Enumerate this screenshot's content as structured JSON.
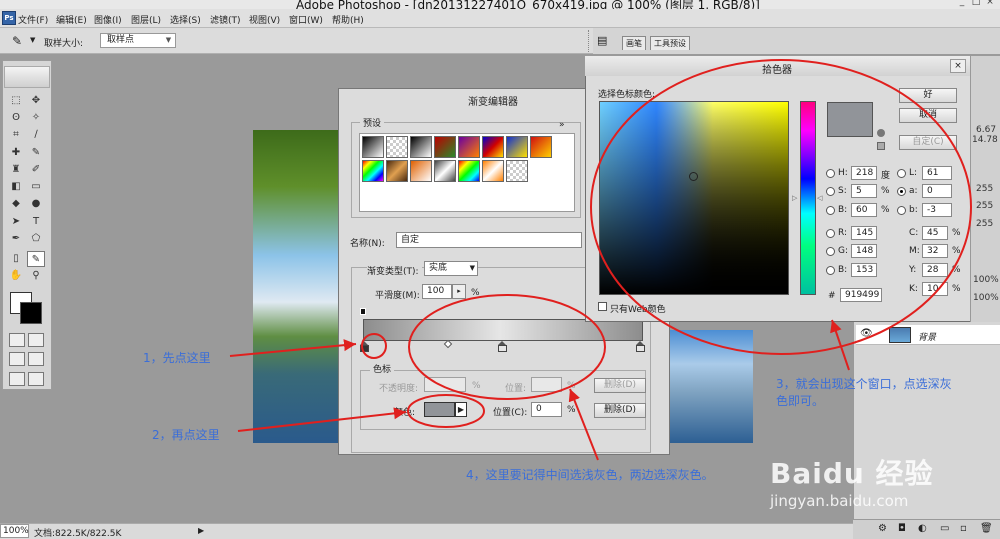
{
  "window": {
    "title": "Adobe Photoshop - [dn20131227401O_670x419.jpg @ 100% (图层 1, RGB/8)]",
    "controls": [
      "_",
      "□",
      "×"
    ]
  },
  "menu": [
    "文件(F)",
    "编辑(E)",
    "图像(I)",
    "图层(L)",
    "选择(S)",
    "滤镜(T)",
    "视图(V)",
    "窗口(W)",
    "帮助(H)"
  ],
  "options_bar": {
    "sample_size_label": "取样大小:",
    "sample_size_value": "取样点"
  },
  "panel_tabs": [
    "画笔",
    "工具预设"
  ],
  "gradient_editor": {
    "title": "渐变编辑器",
    "presets_label": "预设",
    "presets_more": "»",
    "name_label": "名称(N):",
    "name_value": "自定",
    "gradient_type_label": "渐变类型(T):",
    "gradient_type_value": "实底",
    "smoothness_label": "平滑度(M):",
    "smoothness_value": "100",
    "smoothness_unit": "%",
    "stops_label": "色标",
    "opacity_label": "不透明度:",
    "opacity_unit": "%",
    "location_label_dim": "位置:",
    "location_unit_dim": "%",
    "delete_label_dim": "删除(D)",
    "color_label": "颜色:",
    "location_label": "位置(C):",
    "location_value": "0",
    "location_unit": "%",
    "delete_label": "删除(D)"
  },
  "color_picker": {
    "title": "拾色器",
    "prompt": "选择色标颜色:",
    "ok_label": "好",
    "cancel_label": "取消",
    "custom_label": "自定(C)",
    "web_only_label": "只有Web颜色",
    "hex_label": "#",
    "hex_value": "919499",
    "fields": {
      "H": {
        "label": "H:",
        "value": "218",
        "unit": "度"
      },
      "S": {
        "label": "S:",
        "value": "5",
        "unit": "%"
      },
      "B": {
        "label": "B:",
        "value": "60",
        "unit": "%"
      },
      "R": {
        "label": "R:",
        "value": "145"
      },
      "G": {
        "label": "G:",
        "value": "148"
      },
      "Bl": {
        "label": "B:",
        "value": "153"
      },
      "L": {
        "label": "L:",
        "value": "61"
      },
      "a": {
        "label": "a:",
        "value": "0"
      },
      "b": {
        "label": "b:",
        "value": "-3"
      },
      "C": {
        "label": "C:",
        "value": "45",
        "unit": "%"
      },
      "M": {
        "label": "M:",
        "value": "32",
        "unit": "%"
      },
      "Y": {
        "label": "Y:",
        "value": "28",
        "unit": "%"
      },
      "K": {
        "label": "K:",
        "value": "10",
        "unit": "%"
      }
    }
  },
  "right_panel": {
    "nums": [
      "6.67",
      "14.78",
      "255",
      "255",
      "255",
      "100%",
      "100%"
    ],
    "layer_name": "背景"
  },
  "status_bar": {
    "zoom": "100%",
    "doc_info": "文档:822.5K/822.5K",
    "arrow": "▶"
  },
  "annotations": {
    "step1": "1，先点这里",
    "step2": "2，再点这里",
    "step3_line1": "3，就会出现这个窗口，点选深灰",
    "step3_line2": "色即可。",
    "step4": "4，这里要记得中间选浅灰色，两边选深灰色。"
  },
  "watermark": {
    "logo": "Baidu 经验",
    "url": "jingyan.baidu.com"
  },
  "colors": {
    "selected_gray": "#919499",
    "annotation_blue": "#3b6ed8",
    "annotation_red": "#e0201e"
  }
}
